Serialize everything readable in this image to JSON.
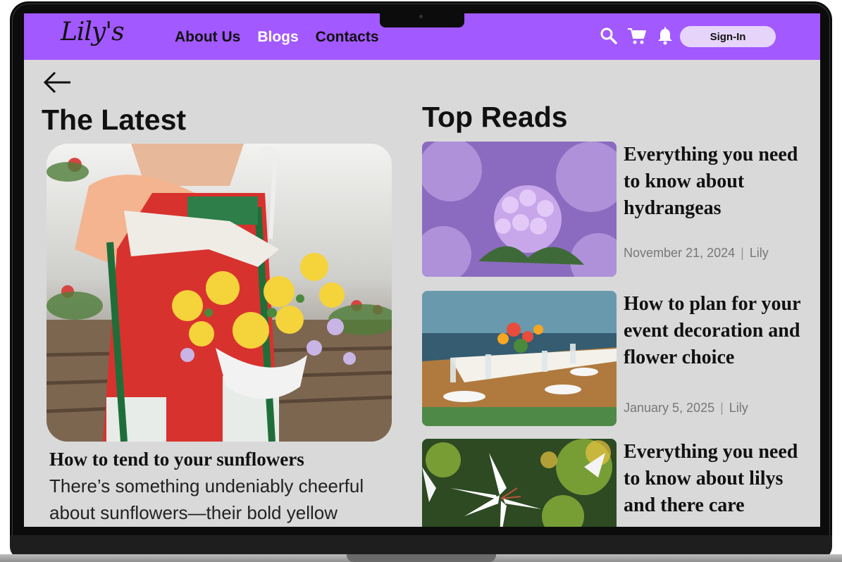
{
  "header": {
    "logo": "Lily's",
    "nav": [
      {
        "label": "About Us",
        "active": false
      },
      {
        "label": "Blogs",
        "active": true
      },
      {
        "label": "Contacts",
        "active": false
      }
    ],
    "icons": [
      "search-icon",
      "cart-icon",
      "bell-icon"
    ],
    "signin_label": "Sign-In"
  },
  "latest": {
    "heading": "The Latest",
    "title": "How to tend to your sunflowers",
    "excerpt": "There’s something undeniably cheerful about sunflowers—their bold yellow"
  },
  "top_reads": {
    "heading": "Top Reads",
    "items": [
      {
        "title": "Everything you need to know about hydrangeas",
        "date": "November 21, 2024",
        "author": "Lily"
      },
      {
        "title": "How to plan for your event decoration and flower choice",
        "date": "January 5, 2025",
        "author": "Lily"
      },
      {
        "title": "Everything you need to know about lilys and there care"
      }
    ]
  },
  "colors": {
    "accent": "#a259ff",
    "signin_bg": "#e6d4fb",
    "page_bg": "#d9d9d9"
  }
}
